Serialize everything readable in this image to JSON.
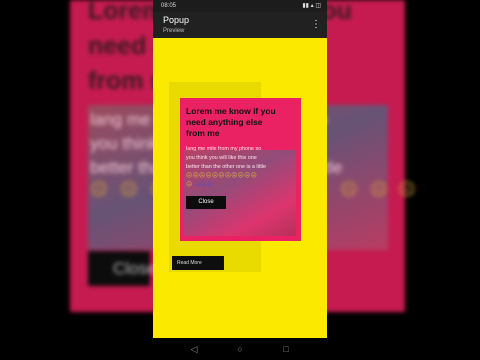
{
  "status_bar": {
    "time": "08:05",
    "signal": "▮▮ ▴ ◫"
  },
  "app_bar": {
    "title": "Popup",
    "subtitle": "Preview",
    "menu_icon": "⋮"
  },
  "background_zoom": {
    "title": "Lorem me know if you\nneed anything else\nfrom me",
    "body": "lang me mile from my phone so\nyou think you will like this one\nbetter than the other one is a little",
    "emoji": "☹ ☹ ☹",
    "close_label": "Close"
  },
  "content": {
    "read_more_label": "Read More"
  },
  "popup": {
    "title": "Lorem me know if you\nneed anything else\nfrom me",
    "body": "lang me mile from my phone so\nyou think you will like this one\nbetter than the other one is a little",
    "emoji_yellow": "☹☹☹☹☹☹☹☹☹☹☹",
    "emoji_second": "☹",
    "emoji_blue": "☹☹☹",
    "close_label": "Close"
  },
  "nav": {
    "back_icon": "◁",
    "home_icon": "○",
    "recents_icon": "□"
  },
  "colors": {
    "popup_bg": "#ea2163",
    "content_bg": "#fbea00",
    "appbar_bg": "#212121"
  }
}
